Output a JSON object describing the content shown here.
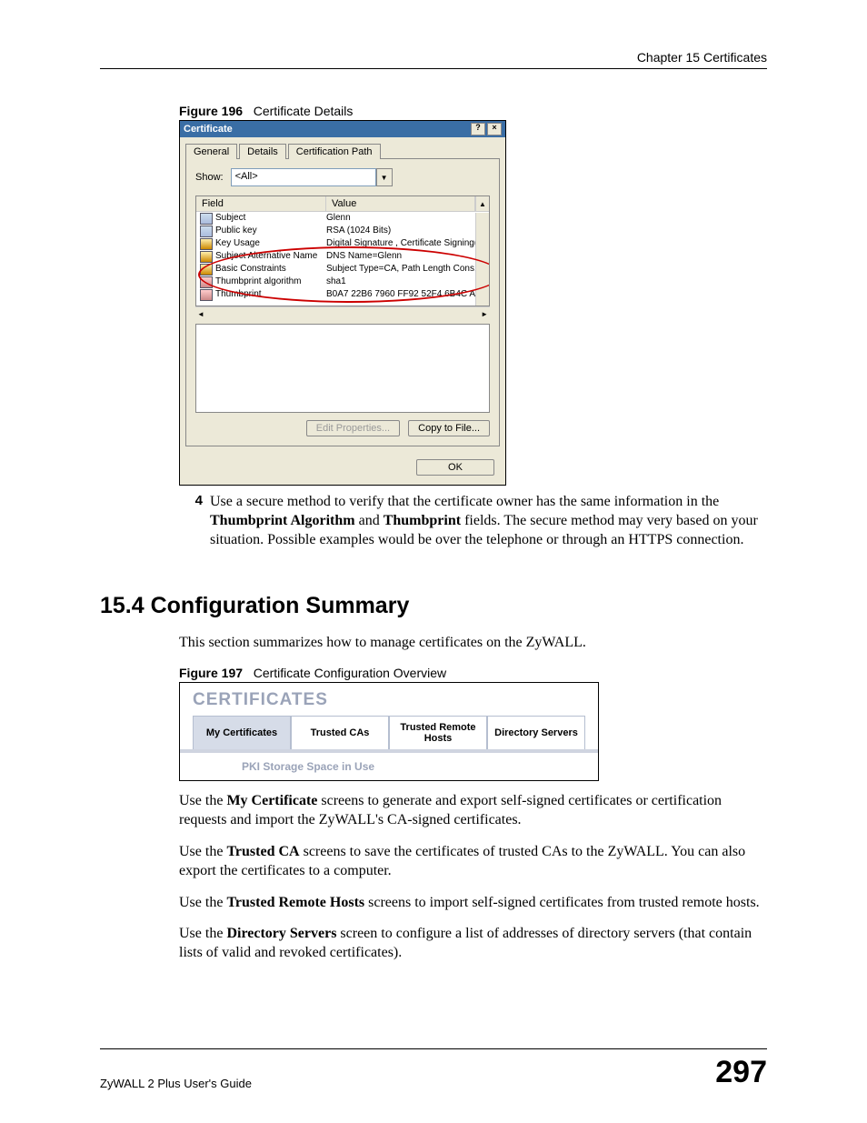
{
  "header": {
    "chapter": "Chapter 15 Certificates"
  },
  "figure196": {
    "label": "Figure 196",
    "caption": "Certificate Details",
    "dialog": {
      "title": "Certificate",
      "help_btn": "?",
      "close_btn": "×",
      "tabs": {
        "general": "General",
        "details": "Details",
        "path": "Certification Path"
      },
      "show_label": "Show:",
      "show_value": "<All>",
      "columns": {
        "field": "Field",
        "value": "Value"
      },
      "rows": [
        {
          "field": "Subject",
          "value": "Glenn",
          "icon": "doc"
        },
        {
          "field": "Public key",
          "value": "RSA (1024 Bits)",
          "icon": "doc"
        },
        {
          "field": "Key Usage",
          "value": "Digital Signature , Certificate Signing(...",
          "icon": "key"
        },
        {
          "field": "Subject Alternative Name",
          "value": "DNS Name=Glenn",
          "icon": "key"
        },
        {
          "field": "Basic Constraints",
          "value": "Subject Type=CA, Path Length Cons...",
          "icon": "key"
        },
        {
          "field": "Thumbprint algorithm",
          "value": "sha1",
          "icon": "th"
        },
        {
          "field": "Thumbprint",
          "value": "B0A7 22B6 7960 FF92 52F4 6B4C A2...",
          "icon": "th"
        }
      ],
      "edit_btn": "Edit Properties...",
      "copy_btn": "Copy to File...",
      "ok_btn": "OK"
    }
  },
  "step4": {
    "num": "4",
    "text_1": "Use a secure method to verify that the certificate owner has the same information in the ",
    "bold_1": "Thumbprint Algorithm",
    "text_2": " and ",
    "bold_2": "Thumbprint",
    "text_3": " fields. The secure method may very based on your situation. Possible examples would be over the telephone or through an HTTPS connection."
  },
  "section": {
    "heading": "15.4  Configuration Summary",
    "intro": "This section summarizes how to manage certificates on the ZyWALL."
  },
  "figure197": {
    "label": "Figure 197",
    "caption": "Certificate Configuration Overview",
    "title": "CERTIFICATES",
    "tabs": {
      "my": "My Certificates",
      "trusted_cas": "Trusted CAs",
      "trusted_remote": "Trusted Remote Hosts",
      "directory": "Directory Servers"
    },
    "subhead": "PKI Storage Space in Use"
  },
  "para1": {
    "a": "Use the ",
    "b": "My Certificate",
    "c": " screens to generate and export self-signed certificates or certification requests and import the ZyWALL's CA-signed certificates."
  },
  "para2": {
    "a": "Use the ",
    "b": "Trusted CA",
    "c": " screens to save the certificates of trusted CAs to the ZyWALL. You can also export the certificates to a computer."
  },
  "para3": {
    "a": "Use the ",
    "b": "Trusted Remote Hosts",
    "c": " screens to import self-signed certificates from trusted remote hosts."
  },
  "para4": {
    "a": "Use the ",
    "b": "Directory Servers",
    "c": " screen to configure a list of addresses of directory servers (that contain lists of valid and revoked certificates)."
  },
  "footer": {
    "guide": "ZyWALL 2 Plus User's Guide",
    "page": "297"
  }
}
